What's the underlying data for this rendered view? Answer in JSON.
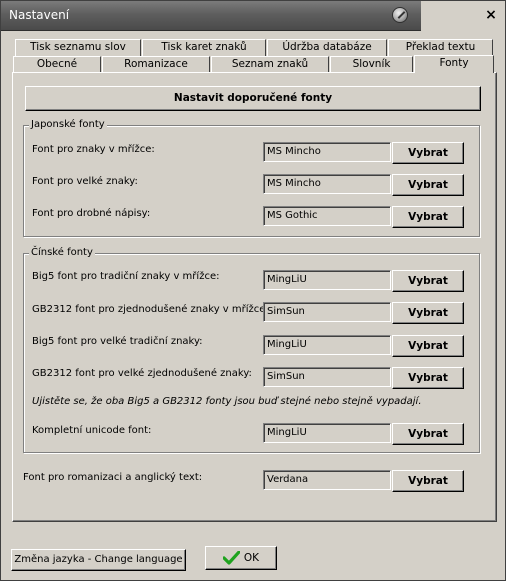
{
  "window": {
    "title": "Nastavení"
  },
  "title_icon": "settings-orb-icon",
  "close_symbol": "×",
  "tabs_row1": [
    "Tisk seznamu slov",
    "Tisk karet znaků",
    "Údržba databáze",
    "Překlad textu"
  ],
  "tabs_row2": [
    "Obecné",
    "Romanizace",
    "Seznam znaků",
    "Slovník",
    "Fonty"
  ],
  "active_tab": "Fonty",
  "recommended_button": "Nastavit doporučené fonty",
  "japanese": {
    "legend": "Japonské fonty",
    "rows": [
      {
        "label": "Font pro znaky v mřížce:",
        "value": "MS Mincho",
        "button": "Vybrat"
      },
      {
        "label": "Font pro velké znaky:",
        "value": "MS Mincho",
        "button": "Vybrat"
      },
      {
        "label": "Font pro drobné nápisy:",
        "value": "MS Gothic",
        "button": "Vybrat"
      }
    ]
  },
  "chinese": {
    "legend": "Čínské fonty",
    "rows": [
      {
        "label": "Big5 font pro tradiční znaky v mřížce:",
        "value": "MingLiU",
        "button": "Vybrat"
      },
      {
        "label": "GB2312 font pro zjednodušené znaky v mřížce:",
        "value": "SimSun",
        "button": "Vybrat"
      },
      {
        "label": "Big5 font pro velké tradiční znaky:",
        "value": "MingLiU",
        "button": "Vybrat"
      },
      {
        "label": "GB2312 font pro velké zjednodušené znaky:",
        "value": "SimSun",
        "button": "Vybrat"
      }
    ],
    "note": "Ujistěte se, že oba Big5 a GB2312 fonty jsou buď stejné nebo stejně vypadají.",
    "unicode": {
      "label": "Kompletní unicode font:",
      "value": "MingLiU",
      "button": "Vybrat"
    }
  },
  "romanization": {
    "label": "Font pro romanizaci a anglický text:",
    "value": "Verdana",
    "button": "Vybrat"
  },
  "footer": {
    "language_button": "Změna jazyka - Change language",
    "ok_button": "OK",
    "ok_icon": "green-checkmark-icon"
  },
  "colors": {
    "titlebar": "#5e5e5e",
    "face": "#d4d0c8",
    "check": "#1fa31f"
  }
}
